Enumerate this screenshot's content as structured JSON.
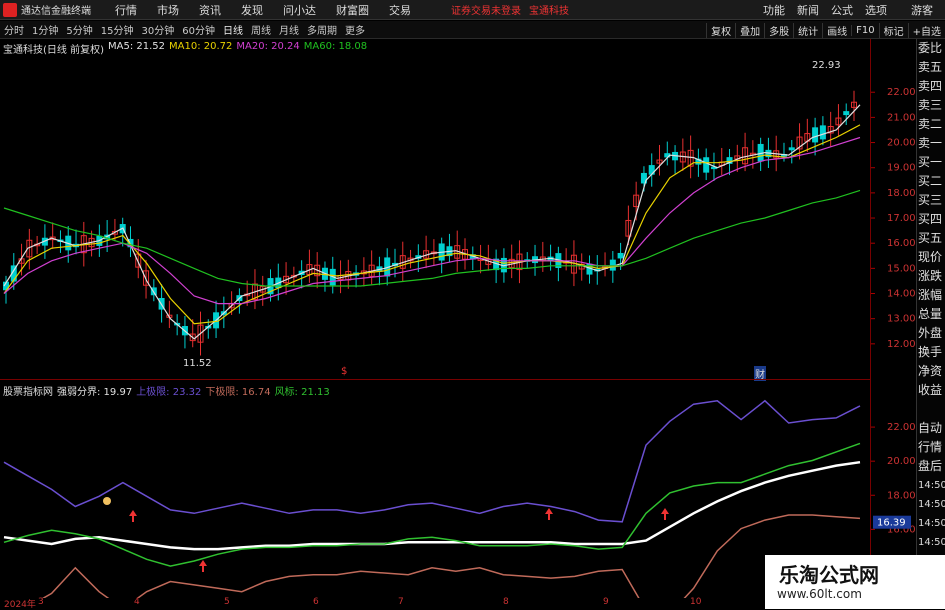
{
  "menubar": {
    "app_name": "通达信金融终端",
    "items": [
      "行情",
      "市场",
      "资讯",
      "发现",
      "问小达",
      "财富圈",
      "交易"
    ],
    "alert": "证券交易未登录",
    "stock": "宝通科技",
    "right_items": [
      "功能",
      "新闻",
      "公式",
      "选项"
    ],
    "guest": "游客"
  },
  "toolbar": {
    "periods": [
      "分时",
      "1分钟",
      "5分钟",
      "15分钟",
      "30分钟",
      "60分钟",
      "日线",
      "周线",
      "月线",
      "多周期",
      "更多"
    ],
    "active": "日线",
    "right_items": [
      "复权",
      "叠加",
      "多股",
      "统计",
      "画线",
      "F10",
      "标记",
      "+自选"
    ]
  },
  "main_chart": {
    "stock_title": "宝通科技(日线 前复权)",
    "ma": [
      {
        "label": "MA5: 21.52",
        "color": "#e0e0e0"
      },
      {
        "label": "MA10: 20.72",
        "color": "#e8d200"
      },
      {
        "label": "MA20: 20.24",
        "color": "#d040d0"
      },
      {
        "label": "MA60: 18.08",
        "color": "#20c020"
      }
    ],
    "high_label": "22.93",
    "low_label": "11.52",
    "event_marks": [
      "$",
      "财"
    ],
    "price_ticks": [
      "22.00",
      "21.00",
      "20.00",
      "19.00",
      "18.00",
      "17.00",
      "16.00",
      "15.00",
      "14.00",
      "13.00",
      "12.00"
    ],
    "ylim": [
      11,
      23.4
    ]
  },
  "sub_chart": {
    "title": "股票指标网",
    "items": [
      {
        "label": "强弱分界: 19.97",
        "color": "#e0e0e0"
      },
      {
        "label": "上极限: 23.32",
        "color": "#6a4fd0"
      },
      {
        "label": "下极限: 16.74",
        "color": "#c06a5a"
      },
      {
        "label": "风标: 21.13",
        "color": "#30c030"
      }
    ],
    "ticks": [
      "22.00",
      "20.00",
      "18.00",
      "16.00",
      "14.00"
    ],
    "current_value": "16.39",
    "ylim": [
      12.5,
      24
    ]
  },
  "xaxis": {
    "labels": [
      "2024年",
      "3",
      "4",
      "5",
      "6",
      "7",
      "8",
      "9",
      "10"
    ]
  },
  "right_panel": {
    "items": [
      "委比",
      "卖五",
      "卖四",
      "卖三",
      "卖二",
      "卖一",
      "买一",
      "买二",
      "买三",
      "买四",
      "买五",
      "现价",
      "涨跌",
      "涨幅",
      "总量",
      "外盘",
      "换手",
      "净资",
      "收益",
      "",
      "自动",
      "行情",
      "盘后",
      "14:50",
      "14:50",
      "14:50",
      "14:50",
      "14:50",
      "14:50",
      "14:50"
    ]
  },
  "watermark": {
    "title": "乐淘公式网",
    "url": "www.60lt.com"
  },
  "chart_data": {
    "type": "line",
    "series": [
      {
        "name": "MA5",
        "color": "#e0e0e0",
        "values": [
          14.3,
          15.8,
          16.2,
          15.9,
          16.1,
          16.6,
          14.5,
          13.0,
          12.2,
          13.0,
          13.9,
          14.2,
          14.6,
          15.0,
          14.6,
          14.8,
          15.0,
          15.3,
          15.6,
          15.7,
          15.4,
          15.1,
          15.3,
          15.4,
          15.2,
          14.9,
          15.2,
          18.5,
          19.5,
          19.4,
          19.0,
          19.4,
          19.6,
          19.5,
          20.2,
          20.5,
          21.5
        ]
      },
      {
        "name": "MA10",
        "color": "#e8d200",
        "values": [
          14.0,
          15.3,
          15.8,
          15.9,
          16.0,
          16.3,
          15.2,
          13.8,
          12.8,
          12.9,
          13.6,
          14.0,
          14.4,
          14.8,
          14.7,
          14.8,
          14.9,
          15.2,
          15.4,
          15.6,
          15.5,
          15.2,
          15.3,
          15.3,
          15.2,
          15.0,
          15.1,
          17.2,
          18.6,
          19.2,
          19.2,
          19.3,
          19.5,
          19.4,
          19.8,
          20.2,
          20.7
        ]
      },
      {
        "name": "MA20",
        "color": "#d040d0",
        "values": [
          14.0,
          14.8,
          15.3,
          15.6,
          15.8,
          16.0,
          15.6,
          14.8,
          13.9,
          13.6,
          13.6,
          13.8,
          14.1,
          14.4,
          14.5,
          14.6,
          14.7,
          14.9,
          15.1,
          15.3,
          15.4,
          15.3,
          15.3,
          15.3,
          15.3,
          15.1,
          15.1,
          16.2,
          17.2,
          18.0,
          18.6,
          19.0,
          19.3,
          19.4,
          19.6,
          19.9,
          20.2
        ]
      },
      {
        "name": "MA60",
        "color": "#20c020",
        "values": [
          17.4,
          17.1,
          16.8,
          16.5,
          16.3,
          16.0,
          15.8,
          15.4,
          15.0,
          14.6,
          14.4,
          14.3,
          14.3,
          14.3,
          14.3,
          14.3,
          14.4,
          14.5,
          14.6,
          14.8,
          14.9,
          15.0,
          15.0,
          15.1,
          15.1,
          15.1,
          15.1,
          15.4,
          15.8,
          16.2,
          16.5,
          16.8,
          17.0,
          17.3,
          17.6,
          17.8,
          18.1
        ]
      }
    ]
  },
  "sub_series": [
    {
      "name": "强弱分界",
      "color": "#ffffff",
      "width": 2.5,
      "values": [
        15.6,
        15.4,
        15.2,
        15.5,
        15.6,
        15.4,
        15.2,
        15.0,
        14.9,
        14.9,
        15.0,
        15.1,
        15.1,
        15.2,
        15.2,
        15.2,
        15.2,
        15.3,
        15.3,
        15.3,
        15.3,
        15.3,
        15.3,
        15.3,
        15.2,
        15.2,
        15.2,
        15.4,
        16.2,
        17.0,
        17.7,
        18.3,
        18.8,
        19.2,
        19.5,
        19.8,
        20.0
      ]
    },
    {
      "name": "上极限",
      "color": "#6a4fd0",
      "width": 1.5,
      "values": [
        20.0,
        19.2,
        18.4,
        17.4,
        18.0,
        18.8,
        18.0,
        17.2,
        17.0,
        17.3,
        17.6,
        17.3,
        17.0,
        17.2,
        17.2,
        17.0,
        17.2,
        17.5,
        17.6,
        17.3,
        17.0,
        17.4,
        17.6,
        17.4,
        17.1,
        16.6,
        16.5,
        21.0,
        22.4,
        23.4,
        23.6,
        22.5,
        23.6,
        22.3,
        22.5,
        22.6,
        23.3
      ]
    },
    {
      "name": "下极限",
      "color": "#c06a5a",
      "width": 1.5,
      "values": [
        11.2,
        11.5,
        12.3,
        13.8,
        12.4,
        11.4,
        12.4,
        13.0,
        12.8,
        12.6,
        12.4,
        13.0,
        13.3,
        13.4,
        13.4,
        13.6,
        13.5,
        13.4,
        13.8,
        13.6,
        13.8,
        13.4,
        13.3,
        13.2,
        13.3,
        13.6,
        13.7,
        11.3,
        11.1,
        12.6,
        14.8,
        16.1,
        16.6,
        16.9,
        16.9,
        16.8,
        16.7
      ]
    },
    {
      "name": "风标",
      "color": "#30c030",
      "width": 1.5,
      "values": [
        15.3,
        15.7,
        16.0,
        15.8,
        15.5,
        14.9,
        14.3,
        13.9,
        14.2,
        14.6,
        14.9,
        15.0,
        15.0,
        15.1,
        15.1,
        15.2,
        15.2,
        15.5,
        15.6,
        15.4,
        15.1,
        15.1,
        15.1,
        15.2,
        15.1,
        14.9,
        15.0,
        17.0,
        18.2,
        18.6,
        18.8,
        18.8,
        19.3,
        19.8,
        20.1,
        20.6,
        21.1
      ]
    }
  ],
  "colors": {
    "up": "#e83030",
    "down": "#00d0d0",
    "axis": "#700000"
  }
}
